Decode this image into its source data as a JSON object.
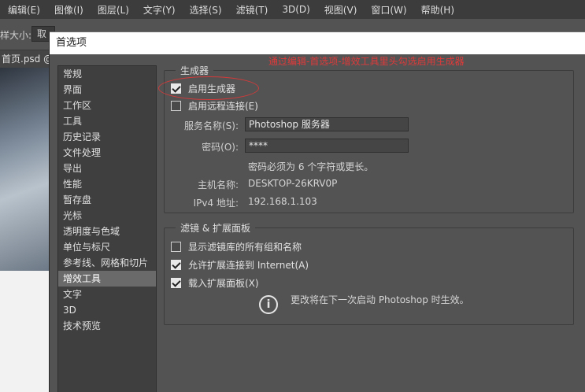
{
  "menubar": {
    "items": [
      "编辑(E)",
      "图像(I)",
      "图层(L)",
      "文字(Y)",
      "选择(S)",
      "滤镜(T)",
      "3D(D)",
      "视图(V)",
      "窗口(W)",
      "帮助(H)"
    ]
  },
  "optionsbar": {
    "size_label": "样大小:",
    "size_value": "取"
  },
  "document": {
    "tab_label": "首页.psd @"
  },
  "dialog": {
    "title": "首选项",
    "annotation": "通过编辑-首选项-增效工具里头勾选启用生成器",
    "nav": {
      "items": [
        "常规",
        "界面",
        "工作区",
        "工具",
        "历史记录",
        "文件处理",
        "导出",
        "性能",
        "暂存盘",
        "光标",
        "透明度与色域",
        "单位与标尺",
        "参考线、网格和切片",
        "增效工具",
        "文字",
        "3D",
        "技术预览"
      ],
      "active_index": 13
    },
    "generator": {
      "group_title": "生成器",
      "enable_generator": {
        "label": "启用生成器",
        "checked": true
      },
      "enable_remote": {
        "label": "启用远程连接(E)",
        "checked": false
      },
      "service_name_label": "服务名称(S):",
      "service_name_value": "Photoshop 服务器",
      "password_label": "密码(O):",
      "password_value": "****",
      "password_hint": "密码必须为 6 个字符或更长。",
      "host_label": "主机名称:",
      "host_value": "DESKTOP-26KRV0P",
      "ipv4_label": "IPv4 地址:",
      "ipv4_value": "192.168.1.103"
    },
    "filters": {
      "group_title": "滤镜 & 扩展面板",
      "show_all_groups": {
        "label": "显示滤镜库的所有组和名称",
        "checked": false
      },
      "allow_internet": {
        "label": "允许扩展连接到 Internet(A)",
        "checked": true
      },
      "load_panels": {
        "label": "载入扩展面板(X)",
        "checked": true
      },
      "notice": "更改将在下一次启动 Photoshop 时生效。"
    }
  }
}
